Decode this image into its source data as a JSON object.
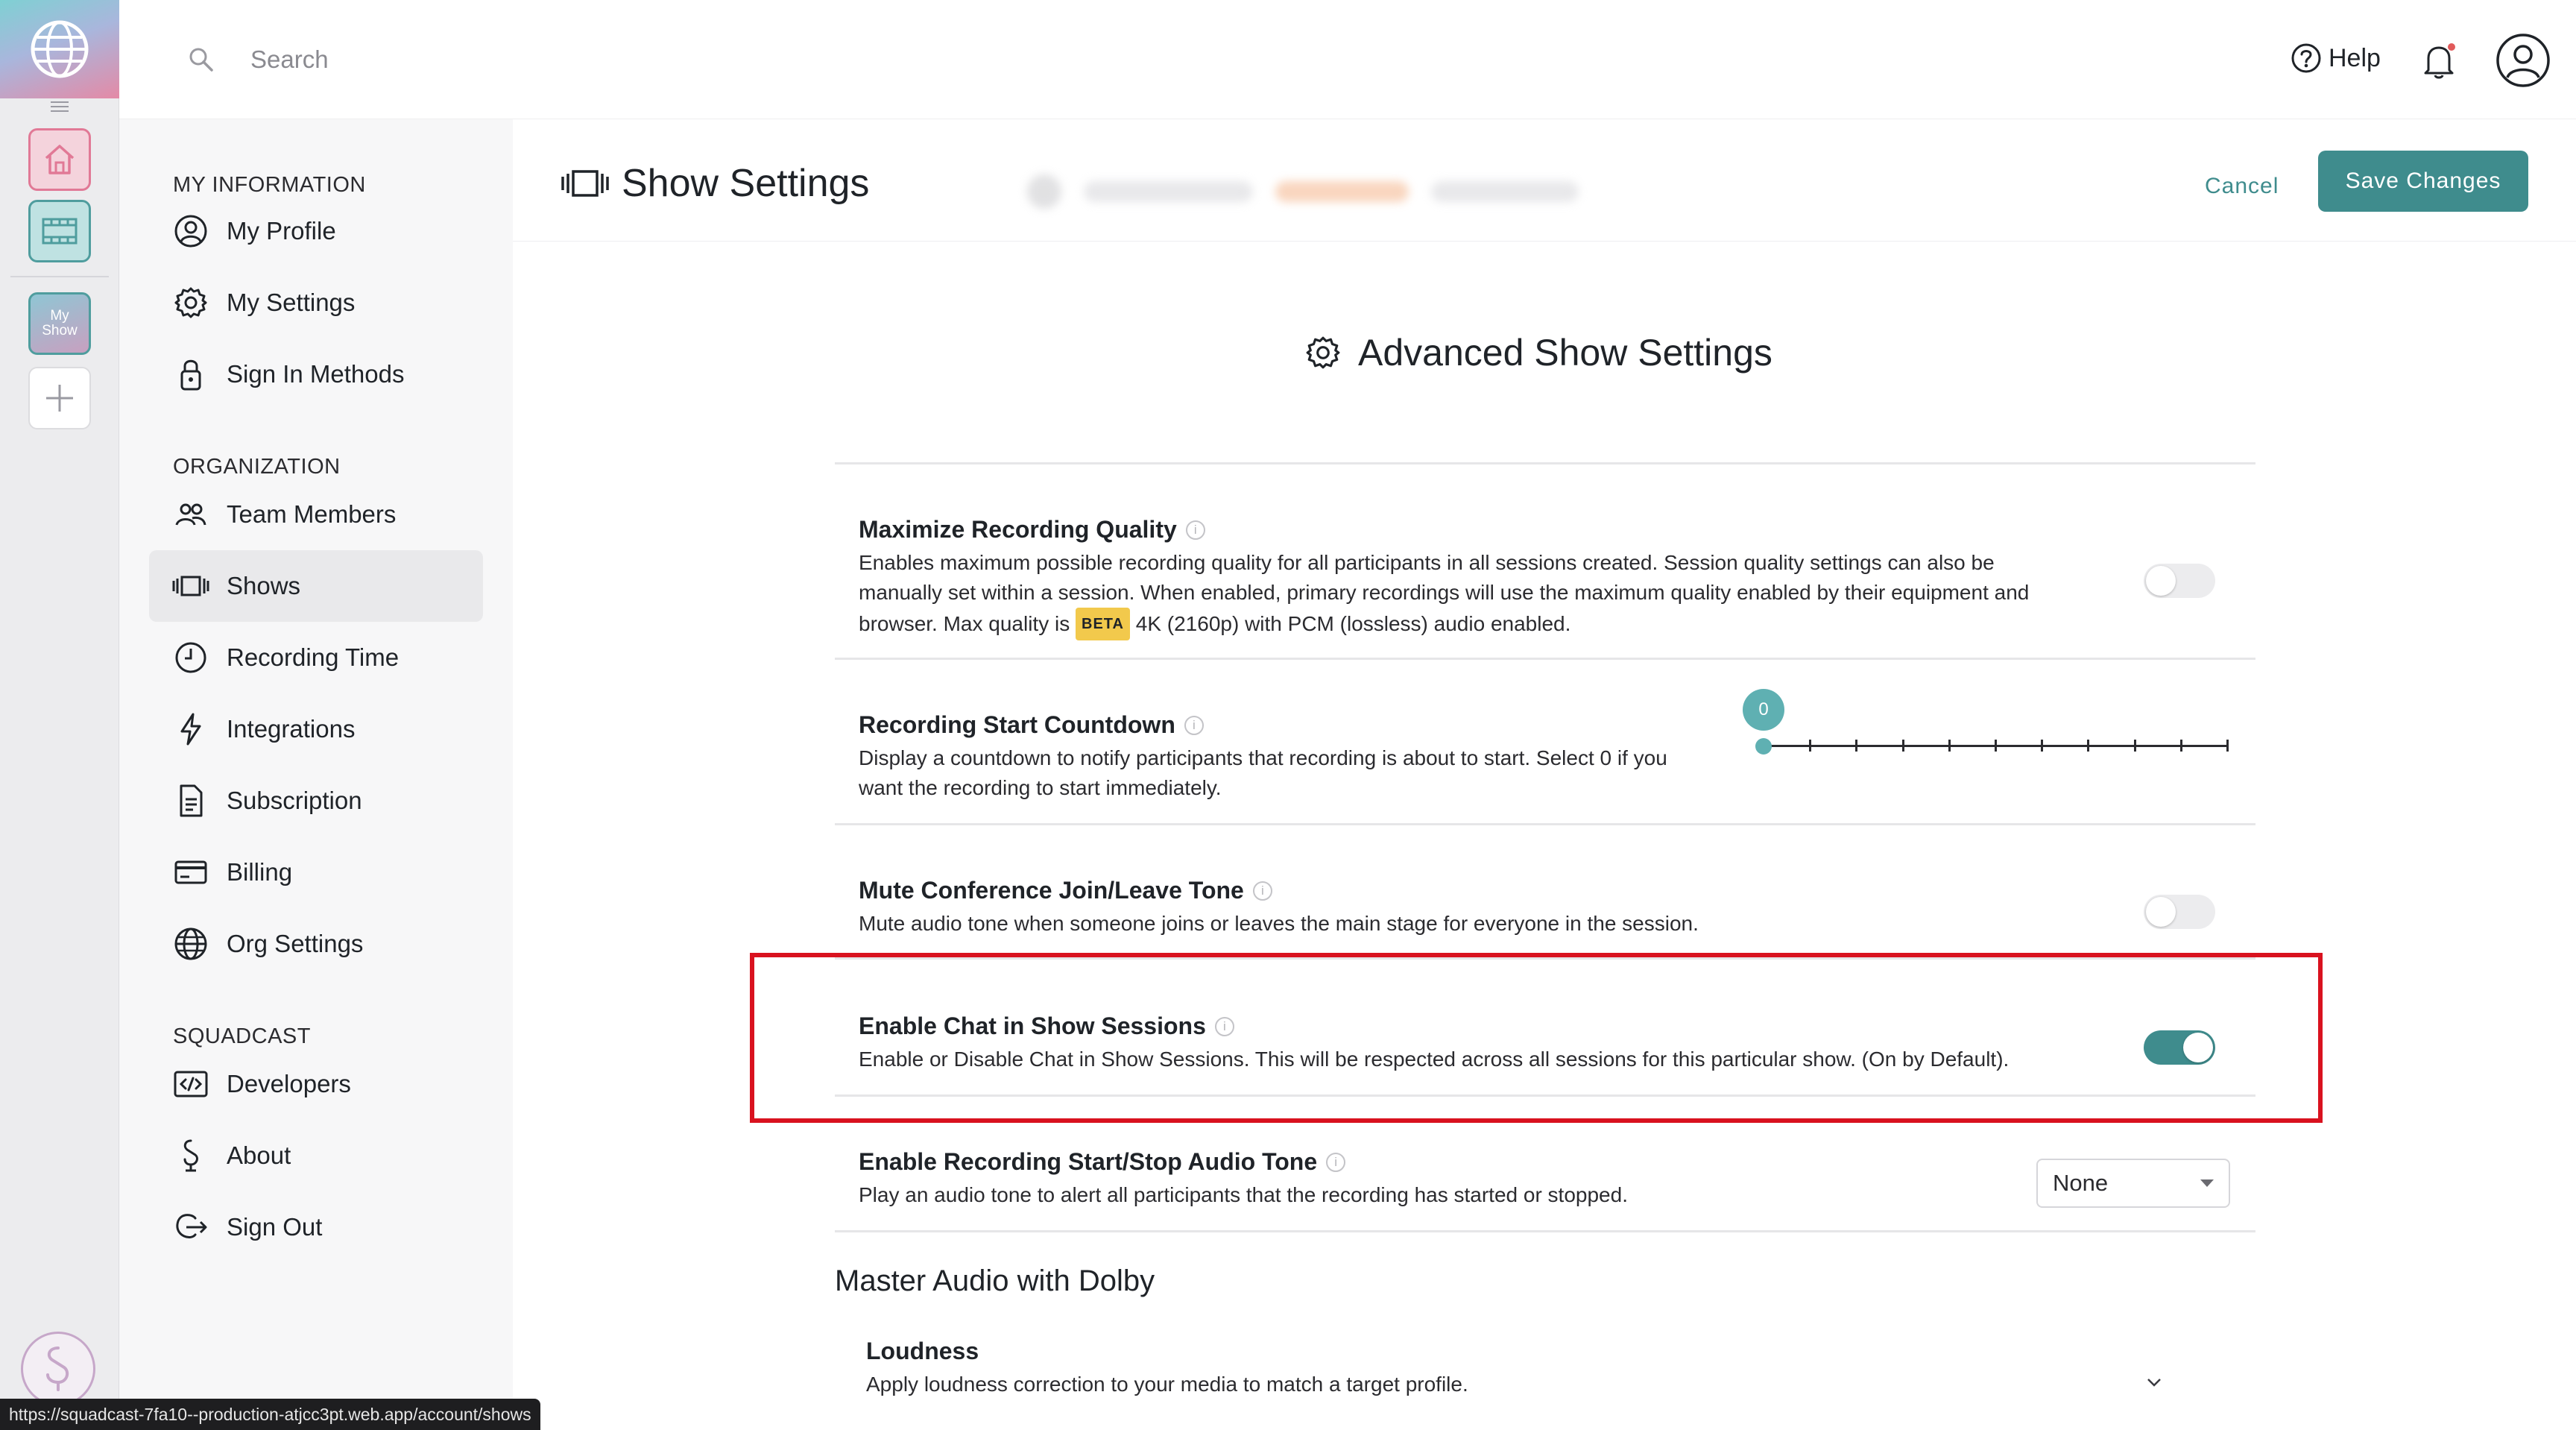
{
  "topbar": {
    "search_placeholder": "Search",
    "help_label": "Help"
  },
  "rail": {
    "my_show_tile_line1": "My",
    "my_show_tile_line2": "Show"
  },
  "sidebar": {
    "sections": [
      {
        "label": "MY INFORMATION",
        "items": [
          "My Profile",
          "My Settings",
          "Sign In Methods"
        ]
      },
      {
        "label": "ORGANIZATION",
        "items": [
          "Team Members",
          "Shows",
          "Recording Time",
          "Integrations",
          "Subscription",
          "Billing",
          "Org Settings"
        ]
      },
      {
        "label": "SQUADCAST",
        "items": [
          "Developers",
          "About",
          "Sign Out"
        ]
      }
    ],
    "active_item": "Shows"
  },
  "header": {
    "title": "Show Settings",
    "cancel_label": "Cancel",
    "save_label": "Save Changes"
  },
  "content": {
    "advanced_title": "Advanced Show Settings",
    "settings": [
      {
        "title": "Maximize Recording Quality",
        "description_part1": "Enables maximum possible recording quality for all participants in all sessions created. Session quality settings can also be manually set within a session. When enabled, primary recordings will use the maximum quality enabled by their equipment and browser. Max quality is",
        "badge": "BETA",
        "description_part2": "4K (2160p) with PCM (lossless) audio enabled.",
        "control": "toggle",
        "enabled": false
      },
      {
        "title": "Recording Start Countdown",
        "description": "Display a countdown to notify participants that recording is about to start. Select 0 if you want the recording to start immediately.",
        "control": "slider",
        "value": "0",
        "value_number": 0,
        "slider_max": 10
      },
      {
        "title": "Mute Conference Join/Leave Tone",
        "description": "Mute audio tone when someone joins or leaves the main stage for everyone in the session.",
        "control": "toggle",
        "enabled": false
      },
      {
        "title": "Enable Chat in Show Sessions",
        "description": "Enable or Disable Chat in Show Sessions. This will be respected across all sessions for this particular show. (On by Default).",
        "control": "toggle",
        "enabled": true
      },
      {
        "title": "Enable Recording Start/Stop Audio Tone",
        "description": "Play an audio tone to alert all participants that the recording has started or stopped.",
        "control": "select",
        "selected": "None"
      }
    ],
    "section_heading": "Master Audio with Dolby",
    "loudness": {
      "title": "Loudness",
      "description": "Apply loudness correction to your media to match a target profile."
    }
  },
  "status_url": "https://squadcast-7fa10--production-atjcc3pt.web.app/account/shows",
  "colors": {
    "accent": "#3f8c8d",
    "highlight_box": "#d9121f",
    "sidebar_bg": "#f7f7f8",
    "rail_bg": "#ececee"
  }
}
